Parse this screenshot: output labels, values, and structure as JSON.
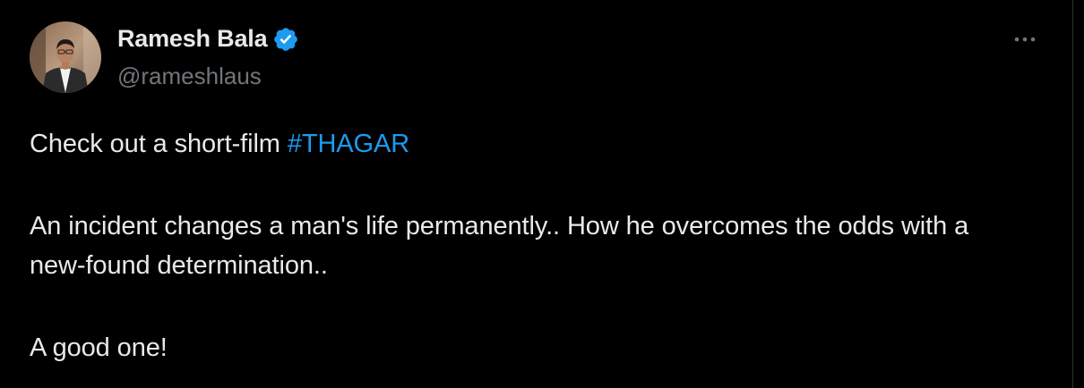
{
  "author": {
    "display_name": "Ramesh Bala",
    "handle": "@rameshlaus",
    "verified": true
  },
  "tweet": {
    "line1_text": "Check out a short-film ",
    "line1_hashtag": "#THAGAR",
    "paragraph2": "An incident changes a man's life permanently.. How he overcomes the odds with a new-found determination..",
    "paragraph3": "A good one!"
  },
  "icons": {
    "verified": "verified-badge-icon",
    "more": "more-options-icon"
  },
  "colors": {
    "background": "#000000",
    "text": "#e7e9ea",
    "secondary": "#71767b",
    "link": "#1d9bf0",
    "verified": "#1d9bf0"
  }
}
